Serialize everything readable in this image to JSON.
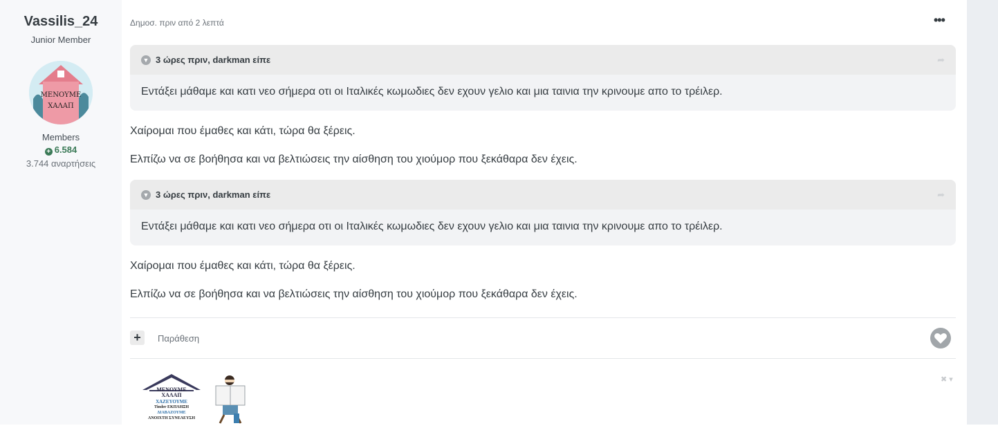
{
  "author": {
    "name": "Vassilis_24",
    "rank": "Junior Member",
    "avatar_text": [
      "ΜΕΝΟΥΜΕ",
      "ΧΑΛΑΠ"
    ],
    "group": "Members",
    "reputation": "6.584",
    "posts": "3.744 αναρτήσεις"
  },
  "post": {
    "date": "Δημοσ. πριν από 2 λεπτά",
    "blocks": [
      {
        "quote_cite": "3 ώρες πριν, darkman είπε",
        "quote_text": "Εντάξει μάθαμε και κατι νεο σήμερα οτι οι Ιταλικές κωμωδιες δεν εχουν γελιο και μια ταινια την κρινουμε απο το τρέιλερ.",
        "para1": "Χαίρομαι που έμαθες και κάτι, τώρα θα ξέρεις.",
        "para2": "Ελπίζω να σε βοήθησα και να βελτιώσεις την αίσθηση του χιούμορ που ξεκάθαρα δεν έχεις."
      },
      {
        "quote_cite": "3 ώρες πριν, darkman είπε",
        "quote_text": "Εντάξει μάθαμε και κατι νεο σήμερα οτι οι Ιταλικές κωμωδιες δεν εχουν γελιο και μια ταινια την κρινουμε απο το τρέιλερ.",
        "para1": "Χαίρομαι που έμαθες και κάτι, τώρα θα ξέρεις.",
        "para2": "Ελπίζω να σε βοήθησα και να βελτιώσεις την αίσθηση του χιούμορ που ξεκάθαρα δεν έχεις."
      }
    ],
    "actions": {
      "plus": "+",
      "quote_label": "Παράθεση"
    }
  },
  "signature": {
    "lines": [
      "ΜΕΝΟΥΜΕ",
      "ΧΑΛΑΠ",
      "ΧΑΖΕΥΟΥΜΕ",
      "Tinder ΕΚΠΛΗΞΗ",
      "ΔΙΑΒΑΖΟΥΜΕ",
      "ΑΝΟΙΧΤΗ ΣΥΝΕΛΕΥΣΗ"
    ]
  },
  "icons": {
    "more": "ellipsis-icon",
    "quote_toggle": "chevron-down-icon",
    "share": "share-arrow-icon",
    "like": "heart-icon",
    "reputation": "plus-circle-icon",
    "signature_toggle": "close-icon"
  },
  "colors": {
    "reputation": "#3b7a57",
    "quote_bg": "#f2f3f5",
    "quote_header_bg": "#ebebeb",
    "like": "#a1a6aa"
  }
}
